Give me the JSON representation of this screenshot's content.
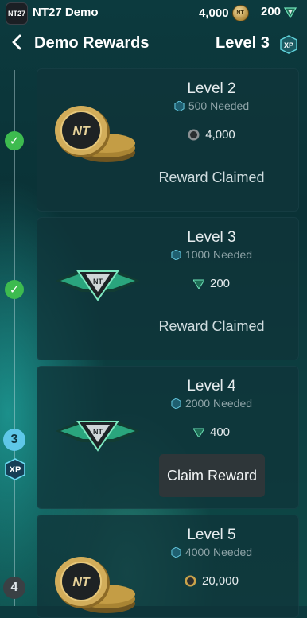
{
  "topbar": {
    "brand_badge": "NT27",
    "app_name": "NT27 Demo",
    "coins": "4,000",
    "points": "200"
  },
  "header": {
    "title": "Demo Rewards",
    "level": "Level 3",
    "xp_badge": "XP"
  },
  "timeline": {
    "current_level": "3",
    "next_level": "4",
    "xp_tag": "XP"
  },
  "cards": [
    {
      "title": "Level 2",
      "needed": "500 Needed",
      "reward": "4,000",
      "reward_type": "coins",
      "status": "Reward Claimed"
    },
    {
      "title": "Level 3",
      "needed": "1000 Needed",
      "reward": "200",
      "reward_type": "points",
      "status": "Reward Claimed"
    },
    {
      "title": "Level 4",
      "needed": "2000 Needed",
      "reward": "400",
      "reward_type": "points",
      "button": "Claim Reward"
    },
    {
      "title": "Level 5",
      "needed": "4000 Needed",
      "reward": "20,000",
      "reward_type": "coins"
    }
  ],
  "icons": {
    "coin_text": "NT",
    "mini_coin_text": "NT"
  },
  "colors": {
    "background": "#0c3a3e",
    "check_green": "#3dbb4f",
    "current_level": "#5ec7e8",
    "gem_green": "#4fd3a4",
    "coin_gold": "#c9a24a"
  }
}
